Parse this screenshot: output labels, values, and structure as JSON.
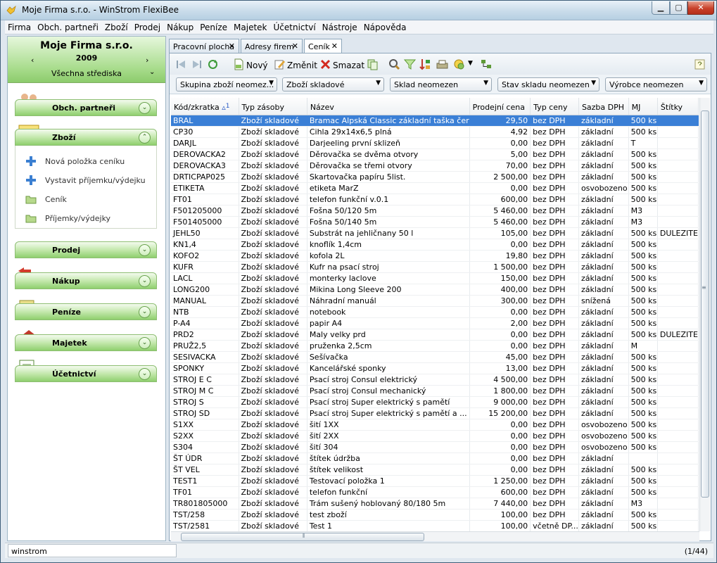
{
  "window": {
    "title": "Moje Firma s.r.o. - WinStrom FlexiBee"
  },
  "menu": [
    "Firma",
    "Obch. partneři",
    "Zboží",
    "Prodej",
    "Nákup",
    "Peníze",
    "Majetek",
    "Účetnictví",
    "Nástroje",
    "Nápověda"
  ],
  "sidebar": {
    "company_name": "Moje Firma s.r.o.",
    "year": "2009",
    "center": "Všechna střediska",
    "sections": [
      "Obch. partneři",
      "Zboží",
      "Prodej",
      "Nákup",
      "Peníze",
      "Majetek",
      "Účetnictví"
    ],
    "zbozi_items": [
      "Nová položka ceníku",
      "Vystavit příjemku/výdejku",
      "Ceník",
      "Příjemky/výdejky"
    ]
  },
  "tabs": [
    {
      "label": "Pracovní plocha"
    },
    {
      "label": "Adresy firem"
    },
    {
      "label": "Ceník"
    }
  ],
  "toolbar": {
    "new_label": "Nový",
    "edit_label": "Změnit",
    "delete_label": "Smazat"
  },
  "filters": [
    "Skupina zboží neomez...",
    "Zboží skladové",
    "Sklad neomezen",
    "Stav skladu neomezen",
    "Výrobce neomezen"
  ],
  "table": {
    "sort_marker": "1",
    "columns": [
      "Kód/zkratka",
      "Typ zásoby",
      "Název",
      "Prodejní cena",
      "Typ ceny",
      "Sazba DPH",
      "MJ",
      "Štítky"
    ],
    "rows": [
      [
        "BRAL",
        "Zboží skladové",
        "Bramac Alpská Classic základní taška čer",
        "29,50",
        "bez DPH",
        "základní",
        "500 ks",
        ""
      ],
      [
        "CP30",
        "Zboží skladové",
        "Cihla 29x14x6,5 plná",
        "4,92",
        "bez DPH",
        "základní",
        "500 ks",
        ""
      ],
      [
        "DARJL",
        "Zboží skladové",
        "Darjeeling první sklizeň",
        "0,00",
        "bez DPH",
        "základní",
        "T",
        ""
      ],
      [
        "DEROVACKA2",
        "Zboží skladové",
        "Děrovačka se dvěma otvory",
        "5,00",
        "bez DPH",
        "základní",
        "500 ks",
        ""
      ],
      [
        "DEROVACKA3",
        "Zboží skladové",
        "Děrovačka se třemi otvory",
        "70,00",
        "bez DPH",
        "základní",
        "500 ks",
        ""
      ],
      [
        "DRTICPAP025",
        "Zboží skladové",
        "Skartovačka papíru 5list.",
        "2 500,00",
        "bez DPH",
        "základní",
        "500 ks",
        ""
      ],
      [
        "ETIKETA",
        "Zboží skladové",
        "etiketa MarZ",
        "0,00",
        "bez DPH",
        "osvobozeno",
        "500 ks",
        ""
      ],
      [
        "FT01",
        "Zboží skladové",
        "telefon funkční v.0.1",
        "600,00",
        "bez DPH",
        "základní",
        "500 ks",
        ""
      ],
      [
        "F501205000",
        "Zboží skladové",
        "Fošna 50/120 5m",
        "5 460,00",
        "bez DPH",
        "základní",
        "M3",
        ""
      ],
      [
        "F501405000",
        "Zboží skladové",
        "Fošna 50/140 5m",
        "5 460,00",
        "bez DPH",
        "základní",
        "M3",
        ""
      ],
      [
        "JEHL50",
        "Zboží skladové",
        "Substrát na jehličnany 50 l",
        "105,00",
        "bez DPH",
        "základní",
        "500 ks",
        "DULEZITE"
      ],
      [
        "KN1,4",
        "Zboží skladové",
        "knoflík 1,4cm",
        "0,00",
        "bez DPH",
        "základní",
        "500 ks",
        ""
      ],
      [
        "KOFO2",
        "Zboží skladové",
        "kofola 2L",
        "19,80",
        "bez DPH",
        "základní",
        "500 ks",
        ""
      ],
      [
        "KUFR",
        "Zboží skladové",
        "Kufr na psací stroj",
        "1 500,00",
        "bez DPH",
        "základní",
        "500 ks",
        ""
      ],
      [
        "LACL",
        "Zboží skladové",
        "monterky laclove",
        "150,00",
        "bez DPH",
        "základní",
        "500 ks",
        ""
      ],
      [
        "LONG200",
        "Zboží skladové",
        "Mikina Long Sleeve 200",
        "400,00",
        "bez DPH",
        "základní",
        "500 ks",
        ""
      ],
      [
        "MANUAL",
        "Zboží skladové",
        "Náhradní manuál",
        "300,00",
        "bez DPH",
        "snížená",
        "500 ks",
        ""
      ],
      [
        "NTB",
        "Zboží skladové",
        "notebook",
        "0,00",
        "bez DPH",
        "základní",
        "500 ks",
        ""
      ],
      [
        "P-A4",
        "Zboží skladové",
        "papir A4",
        "2,00",
        "bez DPH",
        "základní",
        "500 ks",
        ""
      ],
      [
        "PRD2",
        "Zboží skladové",
        "Maly velky prd",
        "0,00",
        "bez DPH",
        "základní",
        "500 ks",
        "DULEZITE"
      ],
      [
        "PRUŽ2,5",
        "Zboží skladové",
        "pruženka 2,5cm",
        "0,00",
        "bez DPH",
        "základní",
        "M",
        ""
      ],
      [
        "SESIVACKA",
        "Zboží skladové",
        "Sešívačka",
        "45,00",
        "bez DPH",
        "základní",
        "500 ks",
        ""
      ],
      [
        "SPONKY",
        "Zboží skladové",
        "Kancelářské sponky",
        "13,00",
        "bez DPH",
        "základní",
        "500 ks",
        ""
      ],
      [
        "STROJ E C",
        "Zboží skladové",
        "Psací stroj Consul elektrický",
        "4 500,00",
        "bez DPH",
        "základní",
        "500 ks",
        ""
      ],
      [
        "STROJ M C",
        "Zboží skladové",
        "Psací stroj Consul mechanický",
        "1 800,00",
        "bez DPH",
        "základní",
        "500 ks",
        ""
      ],
      [
        "STROJ S",
        "Zboží skladové",
        "Psací stroj Super elektrický s pamětí",
        "9 000,00",
        "bez DPH",
        "základní",
        "500 ks",
        ""
      ],
      [
        "STROJ SD",
        "Zboží skladové",
        "Psací stroj Super elektrický s pamětí a ...",
        "15 200,00",
        "bez DPH",
        "základní",
        "500 ks",
        ""
      ],
      [
        "S1XX",
        "Zboží skladové",
        "šití 1XX",
        "0,00",
        "bez DPH",
        "osvobozeno",
        "500 ks",
        ""
      ],
      [
        "S2XX",
        "Zboží skladové",
        "šití 2XX",
        "0,00",
        "bez DPH",
        "osvobozeno",
        "500 ks",
        ""
      ],
      [
        "S304",
        "Zboží skladové",
        "šití 304",
        "0,00",
        "bez DPH",
        "osvobozeno",
        "500 ks",
        ""
      ],
      [
        "ŠT ÚDR",
        "Zboží skladové",
        "štítek údržba",
        "0,00",
        "bez DPH",
        "základní",
        "",
        ""
      ],
      [
        "ŠT VEL",
        "Zboží skladové",
        "štítek velikost",
        "0,00",
        "bez DPH",
        "základní",
        "500 ks",
        ""
      ],
      [
        "TEST1",
        "Zboží skladové",
        "Testovací položka 1",
        "1 250,00",
        "bez DPH",
        "základní",
        "500 ks",
        ""
      ],
      [
        "TF01",
        "Zboží skladové",
        "telefon funkční",
        "600,00",
        "bez DPH",
        "základní",
        "500 ks",
        ""
      ],
      [
        "TR801805000",
        "Zboží skladové",
        "Trám sušený hoblovaný 80/180 5m",
        "7 440,00",
        "bez DPH",
        "základní",
        "M3",
        ""
      ],
      [
        "TST/258",
        "Zboží skladové",
        "test zboží",
        "100,00",
        "bez DPH",
        "základní",
        "500 ks",
        ""
      ],
      [
        "TST/2581",
        "Zboží skladové",
        "Test 1",
        "100,00",
        "včetně DP...",
        "základní",
        "500 ks",
        ""
      ]
    ]
  },
  "status": {
    "user": "winstrom",
    "record": "(1/44)"
  },
  "colors": {
    "selection": "#3a7fd6",
    "sidebar_green": "#8fcf6e"
  }
}
